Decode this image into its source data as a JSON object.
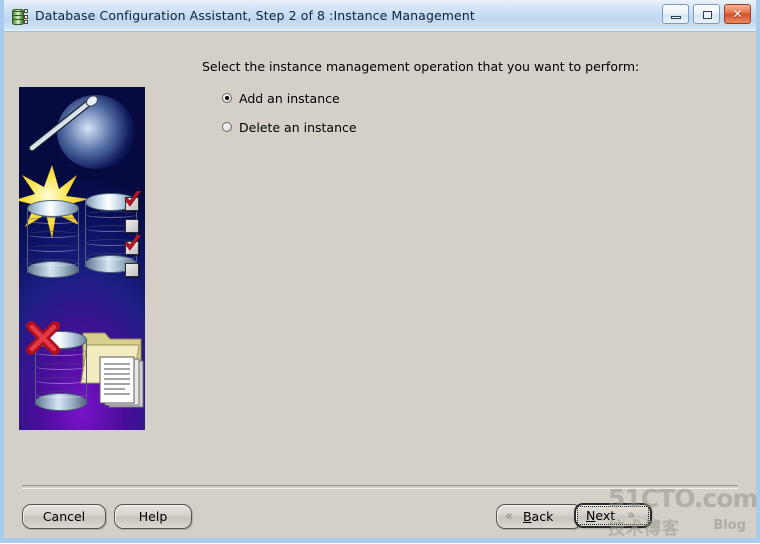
{
  "window": {
    "title": "Database Configuration Assistant, Step 2 of 8 :Instance Management",
    "icon": "database-app-icon",
    "controls": {
      "minimize_label": "",
      "maximize_label": "",
      "close_label": "✕"
    }
  },
  "main": {
    "prompt": "Select the instance management operation that you want to perform:",
    "options": [
      {
        "label": "Add an instance",
        "selected": true
      },
      {
        "label": "Delete an instance",
        "selected": false
      }
    ],
    "illustration": {
      "name": "database-wizard-illustration",
      "description": "Magic wand with sparkle over database cylinders, checklist, red X on a database, and a folder with documents"
    }
  },
  "footer": {
    "cancel_label": "Cancel",
    "help_label": "Help",
    "back_label": "Back",
    "back_mnemonic": "B",
    "next_label": "Next",
    "next_mnemonic": "N",
    "back_chevron": "«",
    "next_chevron": "»"
  },
  "watermark": {
    "top": "51CTO.com",
    "chinese": "技术博客",
    "blog": "Blog"
  },
  "colors": {
    "titlebar_start": "#eaf2fb",
    "titlebar_end": "#bed7f0",
    "window_border": "#a8cced",
    "dialog_face": "#d4d0c8",
    "close_button": "#d2502a",
    "illustration_blue": "#0b1060",
    "illustration_purple": "#7a13c9",
    "accent_red": "#cc1122",
    "accent_yellow": "#f6e02a"
  }
}
